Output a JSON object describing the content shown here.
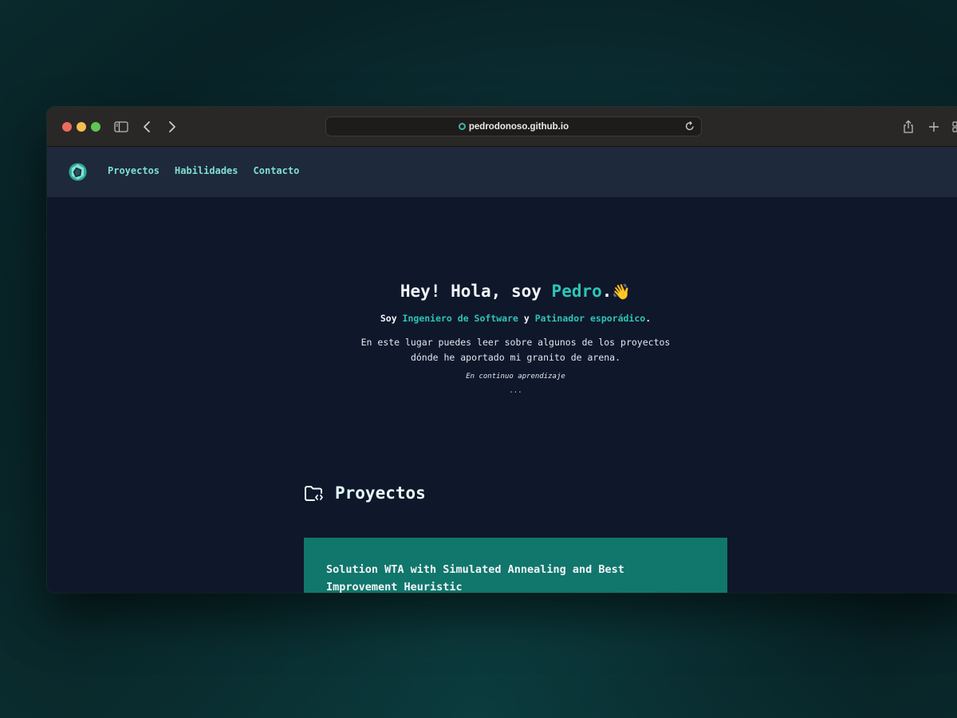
{
  "browser": {
    "address": "pedrodonoso.github.io"
  },
  "nav": {
    "links": [
      "Proyectos",
      "Habilidades",
      "Contacto"
    ]
  },
  "hero": {
    "title_prefix": "Hey! Hola, soy ",
    "title_name": "Pedro",
    "title_suffix": ".",
    "wave_emoji": "👋",
    "sub_prefix": "Soy ",
    "sub_role1": "Ingeniero de Software",
    "sub_mid": " y ",
    "sub_role2": "Patinador esporádico",
    "sub_suffix": ".",
    "desc_line1": "En este lugar puedes leer sobre algunos de los proyectos",
    "desc_line2": "dónde he aportado mi granito de arena.",
    "learning": "En continuo aprendizaje",
    "dots": "..."
  },
  "projects": {
    "heading": "Proyectos",
    "items": [
      {
        "title": "Solution WTA with Simulated Annealing and Best Improvement Heuristic"
      }
    ]
  },
  "colors": {
    "accent": "#2ec4b6",
    "nav_link": "#7ee0cf",
    "card": "#11766b",
    "page_bg": "#0f172a",
    "nav_bg": "#1e293b"
  }
}
